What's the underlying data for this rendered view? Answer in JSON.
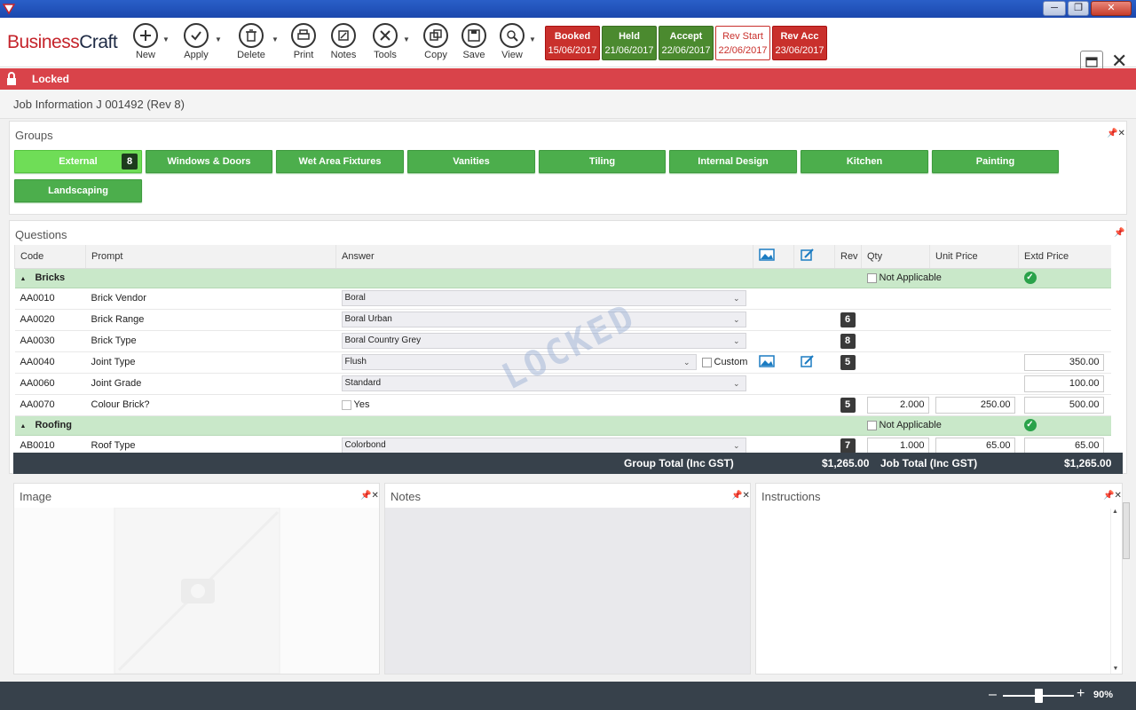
{
  "app": {
    "brand_part1": "Business",
    "brand_part2": "Craft"
  },
  "toolbar": {
    "new": "New",
    "apply": "Apply",
    "delete": "Delete",
    "print": "Print",
    "notes": "Notes",
    "tools": "Tools",
    "copy": "Copy",
    "save": "Save",
    "view": "View"
  },
  "statuses": [
    {
      "name": "Booked",
      "date": "15/06/2017",
      "color": "#c9302c"
    },
    {
      "name": "Held",
      "date": "21/06/2017",
      "color": "#4b8a2f"
    },
    {
      "name": "Accept",
      "date": "22/06/2017",
      "color": "#4b8a2f"
    },
    {
      "name": "Rev Start",
      "date": "22/06/2017",
      "color": "#c9302c"
    },
    {
      "name": "Rev Acc",
      "date": "23/06/2017",
      "color": "#c9302c"
    }
  ],
  "lock": {
    "label": "Locked",
    "watermark": "LOCKED"
  },
  "job": {
    "title": "Job Information J 001492 (Rev 8)"
  },
  "groups": {
    "title": "Groups",
    "items": [
      {
        "label": "External",
        "badge": "8"
      },
      {
        "label": "Windows & Doors"
      },
      {
        "label": "Wet Area Fixtures"
      },
      {
        "label": "Vanities"
      },
      {
        "label": "Tiling"
      },
      {
        "label": "Internal Design"
      },
      {
        "label": "Kitchen"
      },
      {
        "label": "Painting"
      },
      {
        "label": "Landscaping"
      }
    ]
  },
  "questions": {
    "title": "Questions",
    "columns": {
      "code": "Code",
      "prompt": "Prompt",
      "answer": "Answer",
      "rev": "Rev",
      "qty": "Qty",
      "unit_price": "Unit Price",
      "extd_price": "Extd Price"
    },
    "not_applicable": "Not Applicable",
    "custom": "Custom",
    "groups": [
      {
        "name": "Bricks"
      },
      {
        "name": "Roofing"
      }
    ],
    "rows": [
      {
        "code": "AA0010",
        "prompt": "Brick Vendor",
        "answer": "Boral"
      },
      {
        "code": "AA0020",
        "prompt": "Brick Range",
        "answer": "Boral Urban",
        "rev": "6"
      },
      {
        "code": "AA0030",
        "prompt": "Brick Type",
        "answer": "Boral Country Grey",
        "rev": "8"
      },
      {
        "code": "AA0040",
        "prompt": "Joint Type",
        "answer": "Flush",
        "rev": "5",
        "extd": "350.00"
      },
      {
        "code": "AA0060",
        "prompt": "Joint Grade",
        "answer": "Standard",
        "extd": "100.00"
      },
      {
        "code": "AA0070",
        "prompt": "Colour Brick?",
        "answer": "Yes",
        "rev": "5",
        "qty": "2.000",
        "unit": "250.00",
        "extd": "500.00"
      },
      {
        "code": "AB0010",
        "prompt": "Roof Type",
        "answer": "Colorbond",
        "rev": "7",
        "qty": "1.000",
        "unit": "65.00",
        "extd": "65.00"
      }
    ],
    "totals": {
      "group_label": "Group Total (Inc GST)",
      "group_value": "$1,265.00",
      "job_label": "Job Total (Inc GST)",
      "job_value": "$1,265.00"
    }
  },
  "panels": {
    "image": "Image",
    "notes": "Notes",
    "instructions": "Instructions"
  },
  "zoom": {
    "value": "90%",
    "level": 0.5
  }
}
